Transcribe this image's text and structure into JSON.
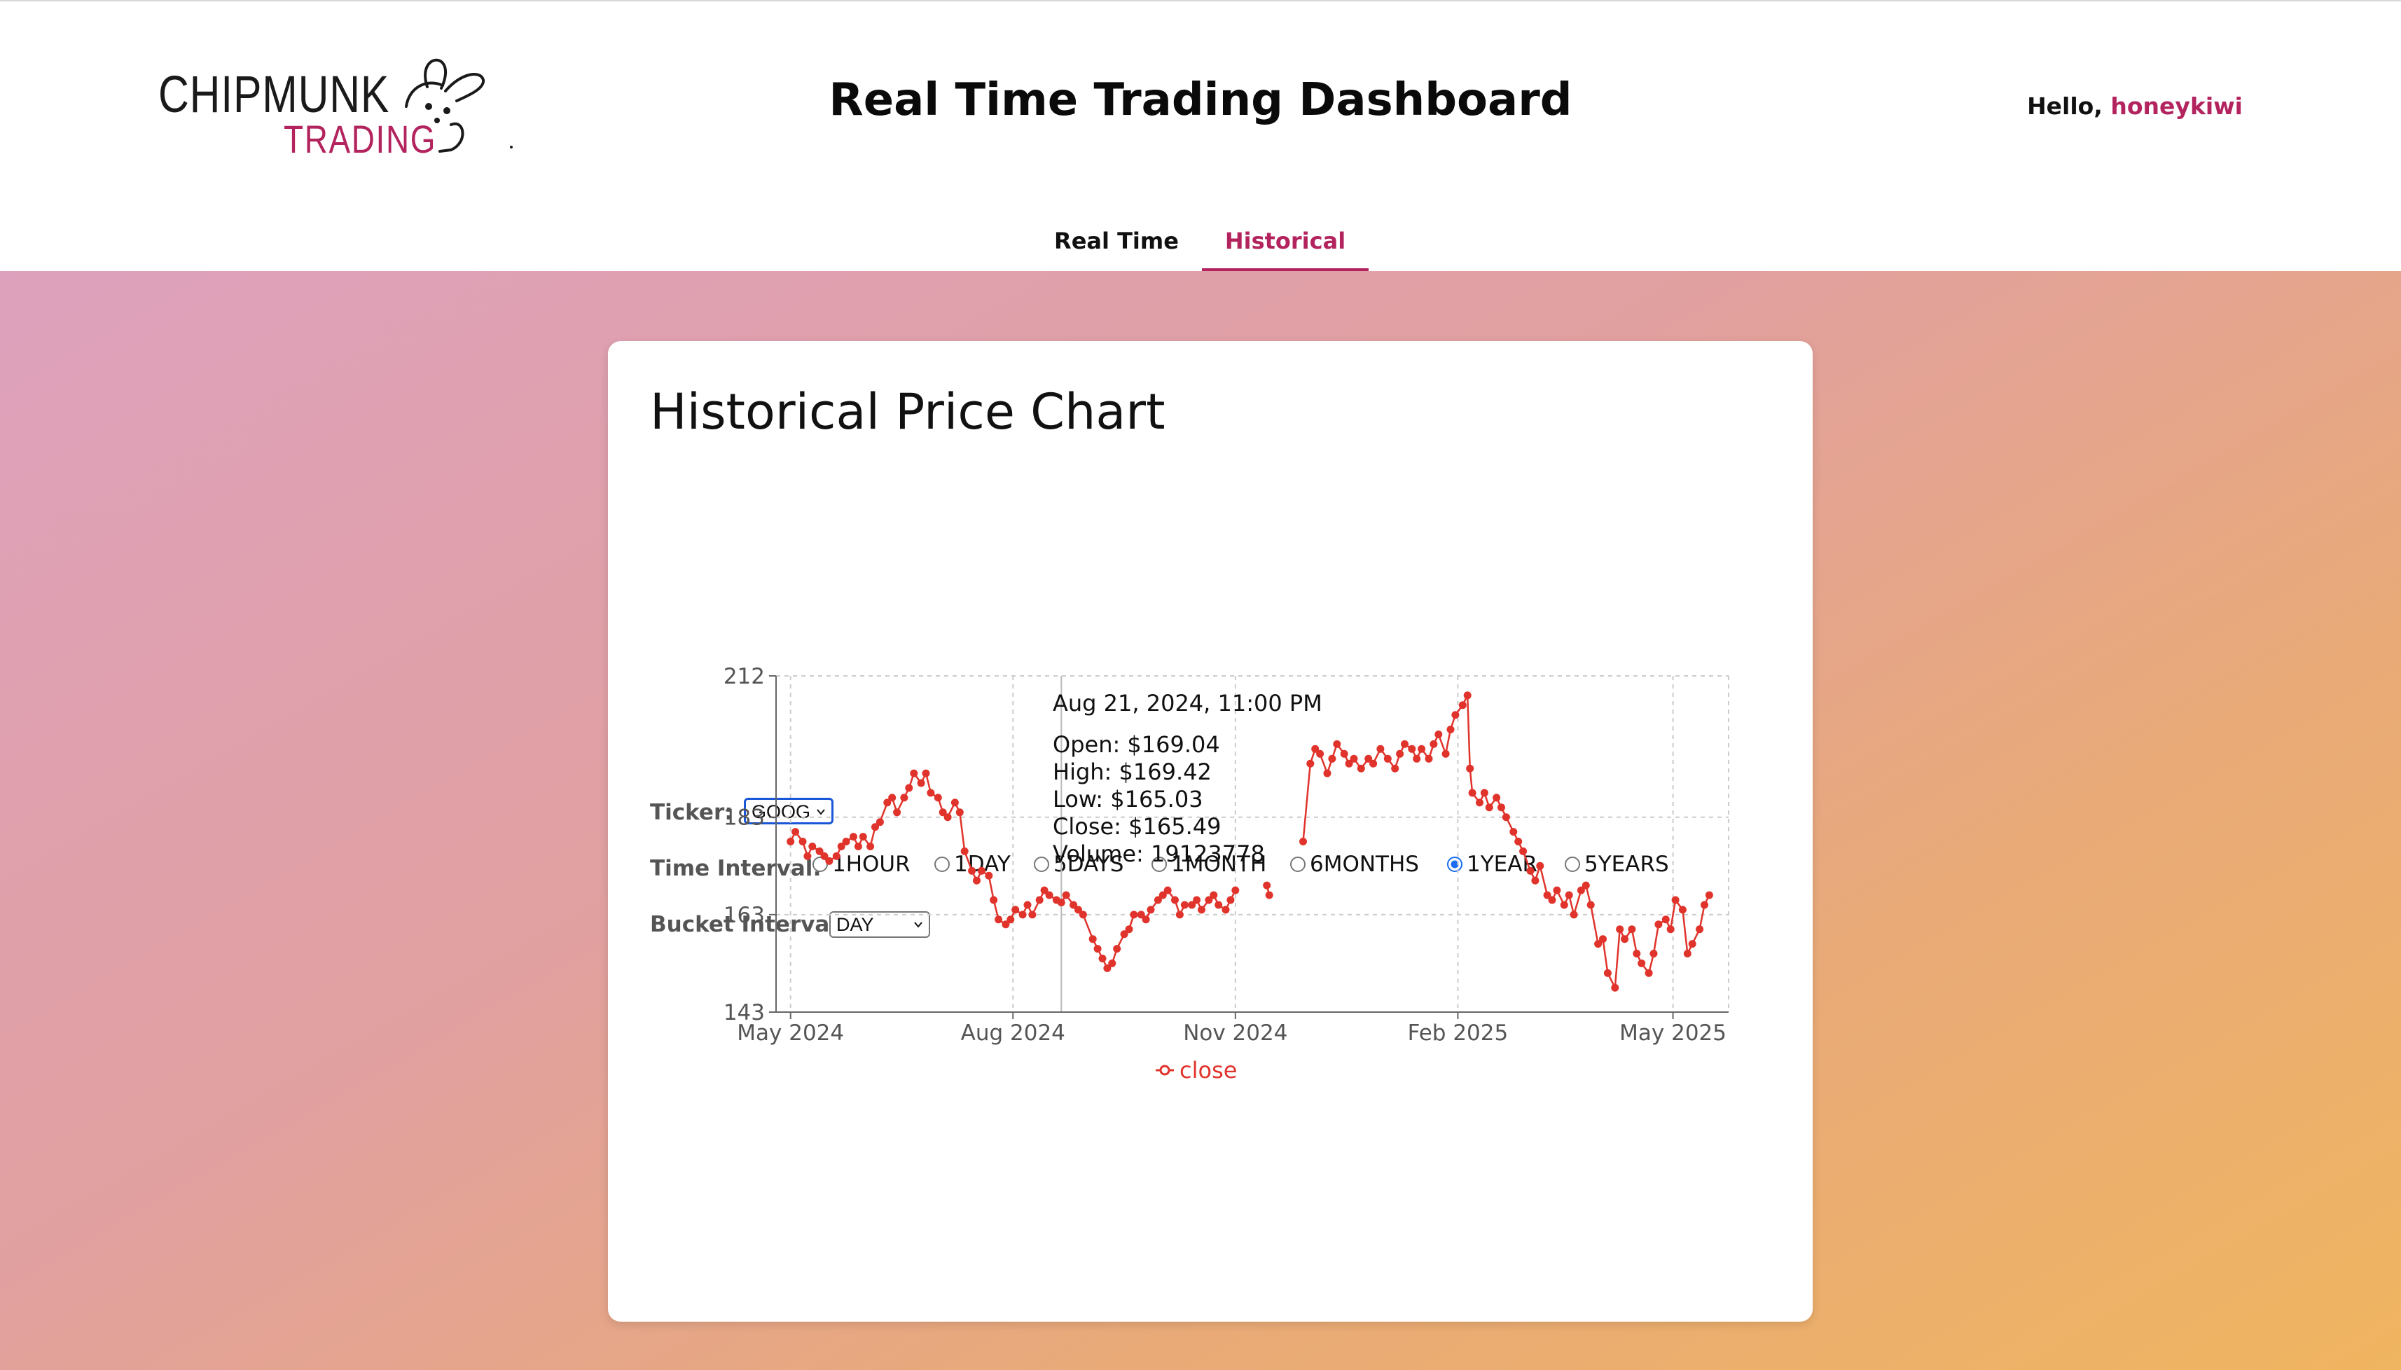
{
  "header": {
    "logo": {
      "line1": "CHIPMUNK",
      "line2": "TRADING",
      "icon": "bunny-logo-icon"
    },
    "title": "Real Time Trading Dashboard",
    "greeting_prefix": "Hello, ",
    "username": "honeykiwi"
  },
  "tabs": [
    {
      "label": "Real Time",
      "active": false
    },
    {
      "label": "Historical",
      "active": true
    }
  ],
  "colors": {
    "accent": "#b3245f",
    "series": "#e0332b",
    "radio_checked": "#1a6df0"
  },
  "card": {
    "title": "Historical Price Chart",
    "ticker_label": "Ticker:",
    "ticker_value": "GOOG",
    "time_interval_label": "Time Interval:",
    "time_intervals": [
      {
        "label": "1HOUR",
        "checked": false
      },
      {
        "label": "1DAY",
        "checked": false
      },
      {
        "label": "5DAYS",
        "checked": false
      },
      {
        "label": "1MONTH",
        "checked": false
      },
      {
        "label": "6MONTHS",
        "checked": false
      },
      {
        "label": "1YEAR",
        "checked": true
      },
      {
        "label": "5YEARS",
        "checked": false
      }
    ],
    "bucket_interval_label": "Bucket Interval:",
    "bucket_interval_value": "DAY"
  },
  "tooltip": {
    "date": "Aug 21, 2024, 11:00 PM",
    "open": "Open: $169.04",
    "high": "High: $169.42",
    "low": "Low: $165.03",
    "close": "Close: $165.49",
    "volume": "Volume: 19123778"
  },
  "chart_data": {
    "type": "line",
    "xlabel": "",
    "ylabel": "",
    "x_ticks": [
      "May 2024",
      "Aug 2024",
      "Nov 2024",
      "Feb 2025",
      "May 2025"
    ],
    "y_ticks": [
      212,
      183,
      163,
      143
    ],
    "ylim": [
      143,
      212
    ],
    "grid": true,
    "legend": "bottom-center",
    "series": [
      {
        "name": "close",
        "points": [
          [
            "2024-05-01",
            178
          ],
          [
            "2024-05-03",
            180
          ],
          [
            "2024-05-06",
            178
          ],
          [
            "2024-05-08",
            175
          ],
          [
            "2024-05-10",
            177
          ],
          [
            "2024-05-13",
            176
          ],
          [
            "2024-05-15",
            175
          ],
          [
            "2024-05-17",
            174
          ],
          [
            "2024-05-20",
            175
          ],
          [
            "2024-05-22",
            177
          ],
          [
            "2024-05-24",
            178
          ],
          [
            "2024-05-27",
            179
          ],
          [
            "2024-05-29",
            177
          ],
          [
            "2024-05-31",
            179
          ],
          [
            "2024-06-03",
            177
          ],
          [
            "2024-06-05",
            181
          ],
          [
            "2024-06-07",
            182
          ],
          [
            "2024-06-10",
            186
          ],
          [
            "2024-06-12",
            187
          ],
          [
            "2024-06-14",
            184
          ],
          [
            "2024-06-17",
            187
          ],
          [
            "2024-06-19",
            189
          ],
          [
            "2024-06-21",
            192
          ],
          [
            "2024-06-24",
            190
          ],
          [
            "2024-06-26",
            192
          ],
          [
            "2024-06-28",
            188
          ],
          [
            "2024-07-01",
            187
          ],
          [
            "2024-07-03",
            184
          ],
          [
            "2024-07-05",
            183
          ],
          [
            "2024-07-08",
            186
          ],
          [
            "2024-07-10",
            184
          ],
          [
            "2024-07-12",
            176
          ],
          [
            "2024-07-15",
            172
          ],
          [
            "2024-07-17",
            170
          ],
          [
            "2024-07-19",
            172
          ],
          [
            "2024-07-22",
            171
          ],
          [
            "2024-07-24",
            166
          ],
          [
            "2024-07-26",
            162
          ],
          [
            "2024-07-29",
            161
          ],
          [
            "2024-07-31",
            162
          ],
          [
            "2024-08-02",
            164
          ],
          [
            "2024-08-05",
            163
          ],
          [
            "2024-08-07",
            165
          ],
          [
            "2024-08-09",
            163
          ],
          [
            "2024-08-12",
            166
          ],
          [
            "2024-08-14",
            168
          ],
          [
            "2024-08-16",
            167
          ],
          [
            "2024-08-19",
            166
          ],
          [
            "2024-08-21",
            165.49
          ],
          [
            "2024-08-23",
            167
          ],
          [
            "2024-08-26",
            165
          ],
          [
            "2024-08-28",
            164
          ],
          [
            "2024-08-30",
            163
          ],
          [
            "2024-09-03",
            158
          ],
          [
            "2024-09-05",
            156
          ],
          [
            "2024-09-07",
            154
          ],
          [
            "2024-09-09",
            152
          ],
          [
            "2024-09-11",
            153
          ],
          [
            "2024-09-13",
            156
          ],
          [
            "2024-09-16",
            159
          ],
          [
            "2024-09-18",
            160
          ],
          [
            "2024-09-20",
            163
          ],
          [
            "2024-09-23",
            163
          ],
          [
            "2024-09-25",
            162
          ],
          [
            "2024-09-27",
            164
          ],
          [
            "2024-09-30",
            166
          ],
          [
            "2024-10-02",
            167
          ],
          [
            "2024-10-04",
            168
          ],
          [
            "2024-10-07",
            166
          ],
          [
            "2024-10-09",
            163
          ],
          [
            "2024-10-11",
            165
          ],
          [
            "2024-10-14",
            165
          ],
          [
            "2024-10-16",
            166
          ],
          [
            "2024-10-18",
            164
          ],
          [
            "2024-10-21",
            166
          ],
          [
            "2024-10-23",
            167
          ],
          [
            "2024-10-25",
            165
          ],
          [
            "2024-10-28",
            164
          ],
          [
            "2024-10-30",
            166
          ],
          [
            "2024-11-01",
            168
          ],
          [
            "2024-11-14",
            169
          ],
          [
            "2024-11-15",
            167
          ],
          [
            "2024-11-29",
            178
          ],
          [
            "2024-12-02",
            194
          ],
          [
            "2024-12-04",
            197
          ],
          [
            "2024-12-06",
            196
          ],
          [
            "2024-12-09",
            192
          ],
          [
            "2024-12-11",
            195
          ],
          [
            "2024-12-13",
            198
          ],
          [
            "2024-12-16",
            196
          ],
          [
            "2024-12-18",
            194
          ],
          [
            "2024-12-20",
            195
          ],
          [
            "2024-12-23",
            193
          ],
          [
            "2024-12-26",
            195
          ],
          [
            "2024-12-28",
            194
          ],
          [
            "2024-12-31",
            197
          ],
          [
            "2025-01-03",
            195
          ],
          [
            "2025-01-06",
            193
          ],
          [
            "2025-01-08",
            196
          ],
          [
            "2025-01-10",
            198
          ],
          [
            "2025-01-13",
            197
          ],
          [
            "2025-01-15",
            195
          ],
          [
            "2025-01-17",
            197
          ],
          [
            "2025-01-20",
            195
          ],
          [
            "2025-01-22",
            198
          ],
          [
            "2025-01-24",
            200
          ],
          [
            "2025-01-27",
            196
          ],
          [
            "2025-01-29",
            201
          ],
          [
            "2025-01-31",
            204
          ],
          [
            "2025-02-03",
            206
          ],
          [
            "2025-02-05",
            208
          ],
          [
            "2025-02-06",
            193
          ],
          [
            "2025-02-07",
            188
          ],
          [
            "2025-02-10",
            186
          ],
          [
            "2025-02-12",
            188
          ],
          [
            "2025-02-14",
            185
          ],
          [
            "2025-02-17",
            187
          ],
          [
            "2025-02-19",
            185
          ],
          [
            "2025-02-21",
            183
          ],
          [
            "2025-02-24",
            180
          ],
          [
            "2025-02-26",
            178
          ],
          [
            "2025-02-28",
            176
          ],
          [
            "2025-03-03",
            172
          ],
          [
            "2025-03-05",
            170
          ],
          [
            "2025-03-07",
            173
          ],
          [
            "2025-03-10",
            167
          ],
          [
            "2025-03-12",
            166
          ],
          [
            "2025-03-14",
            168
          ],
          [
            "2025-03-17",
            165
          ],
          [
            "2025-03-19",
            167
          ],
          [
            "2025-03-21",
            163
          ],
          [
            "2025-03-24",
            168
          ],
          [
            "2025-03-26",
            169
          ],
          [
            "2025-03-28",
            165
          ],
          [
            "2025-03-31",
            157
          ],
          [
            "2025-04-02",
            158
          ],
          [
            "2025-04-04",
            151
          ],
          [
            "2025-04-07",
            148
          ],
          [
            "2025-04-09",
            160
          ],
          [
            "2025-04-11",
            158
          ],
          [
            "2025-04-14",
            160
          ],
          [
            "2025-04-16",
            155
          ],
          [
            "2025-04-18",
            153
          ],
          [
            "2025-04-21",
            151
          ],
          [
            "2025-04-23",
            155
          ],
          [
            "2025-04-25",
            161
          ],
          [
            "2025-04-28",
            162
          ],
          [
            "2025-04-30",
            160
          ],
          [
            "2025-05-02",
            166
          ],
          [
            "2025-05-05",
            164
          ],
          [
            "2025-05-07",
            155
          ],
          [
            "2025-05-09",
            157
          ],
          [
            "2025-05-12",
            160
          ],
          [
            "2025-05-14",
            165
          ],
          [
            "2025-05-16",
            167
          ]
        ]
      }
    ],
    "tooltip_at": "2024-08-21"
  }
}
